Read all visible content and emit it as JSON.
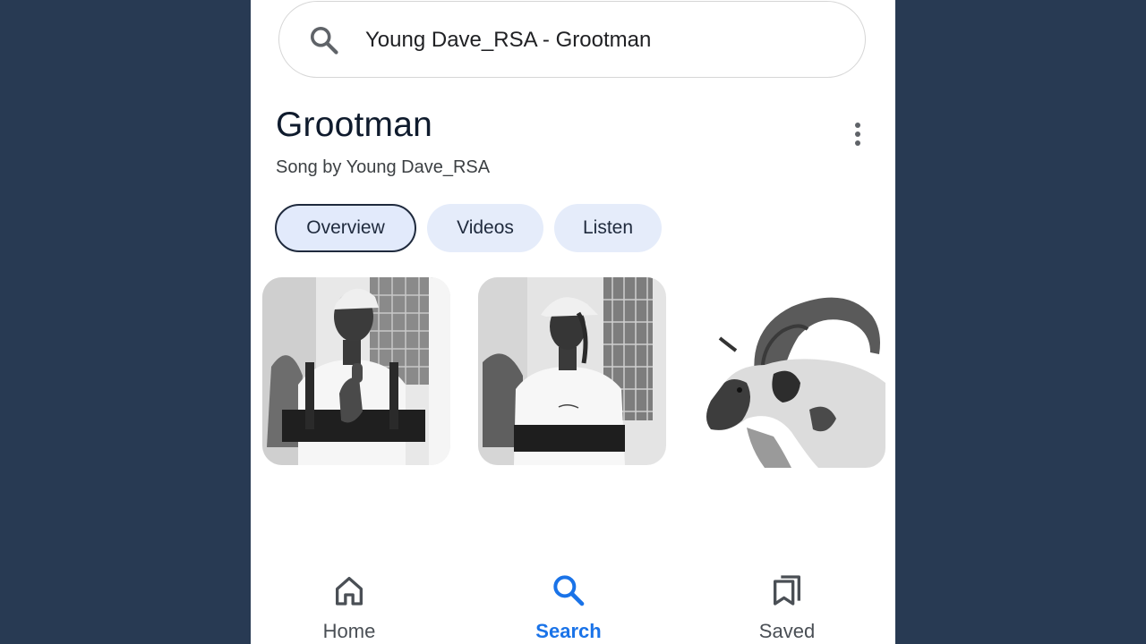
{
  "search": {
    "query": "Young Dave_RSA - Grootman",
    "icon": "search-icon"
  },
  "header": {
    "title": "Grootman",
    "subtitle": "Song by Young Dave_RSA",
    "more_icon": "more-vert-icon"
  },
  "tabs": [
    {
      "label": "Overview",
      "active": true
    },
    {
      "label": "Videos",
      "active": false
    },
    {
      "label": "Listen",
      "active": false
    }
  ],
  "images": [
    "artist-photo-thumbs-up",
    "artist-photo-side-view",
    "goat-photo"
  ],
  "bottom_nav": [
    {
      "label": "Home",
      "icon": "home-icon",
      "active": false
    },
    {
      "label": "Search",
      "icon": "search-icon",
      "active": true
    },
    {
      "label": "Saved",
      "icon": "bookmarks-icon",
      "active": false
    }
  ],
  "colors": {
    "background": "#283a53",
    "accent": "#1a73e8",
    "chip_bg": "#e5ecfa",
    "chip_border": "#1f2a3d"
  }
}
